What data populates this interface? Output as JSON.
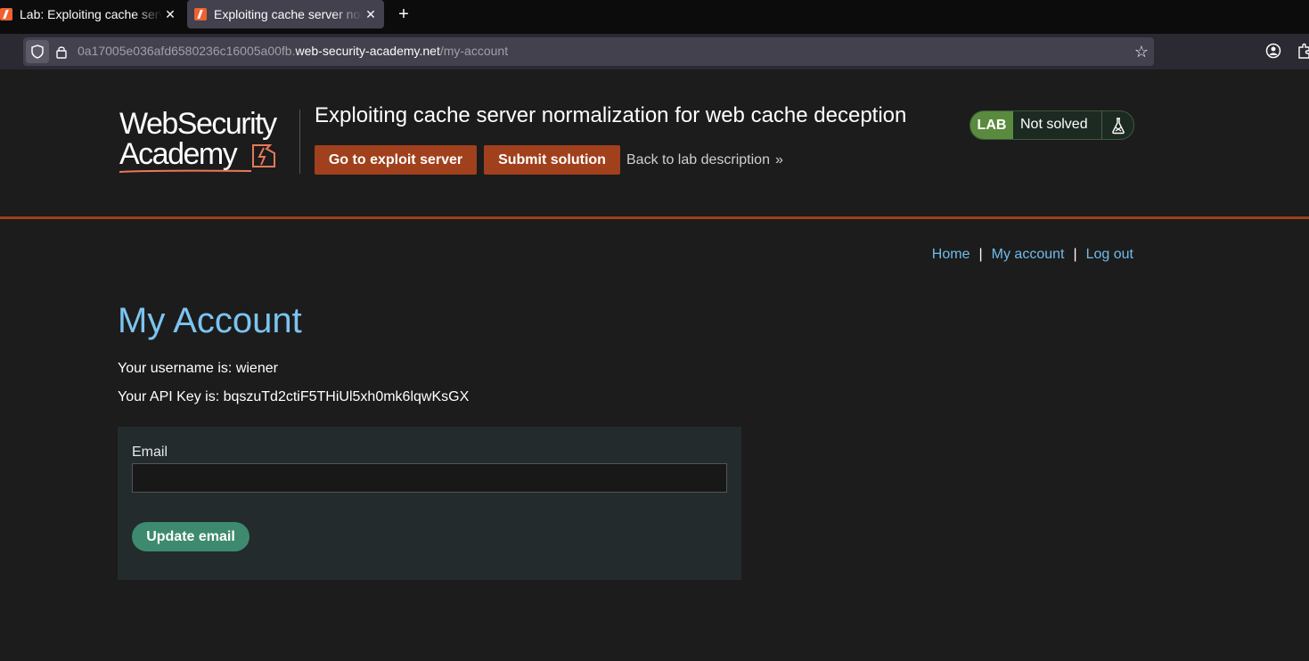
{
  "browser": {
    "tabs": [
      {
        "title": "Lab: Exploiting cache server normalization for web cache deception",
        "close": "✕"
      },
      {
        "title": "Exploiting cache server normalization for web cache deception",
        "close": "✕"
      }
    ],
    "new_tab": "+",
    "url_prefix": "0a17005e036afd6580236c16005a00fb.",
    "url_host": "web-security-academy.net",
    "url_path": "/my-account",
    "bookmark_icon": "☆"
  },
  "header": {
    "logo_line1": "WebSecurity",
    "logo_line2": "Academy",
    "lab_title": "Exploiting cache server normalization for web cache deception",
    "exploit_button": "Go to exploit server",
    "submit_button": "Submit solution",
    "back_link": "Back to lab description",
    "back_chevron": "»",
    "badge_label": "LAB",
    "badge_status": "Not solved"
  },
  "nav": {
    "home": "Home",
    "my_account": "My account",
    "logout": "Log out",
    "separator": "|"
  },
  "main": {
    "title": "My Account",
    "username_text": "Your username is: wiener",
    "api_key_text": "Your API Key is: bqszuTd2ctiF5THiUl5xh0mk6lqwKsGX",
    "email_label": "Email",
    "email_value": "",
    "update_button": "Update email"
  },
  "colors": {
    "accent_orange": "#a0401c",
    "link_blue": "#70bbea",
    "title_blue": "#7cc4f0",
    "lab_green": "#5a8a3e",
    "update_green": "#3e8a6e"
  }
}
